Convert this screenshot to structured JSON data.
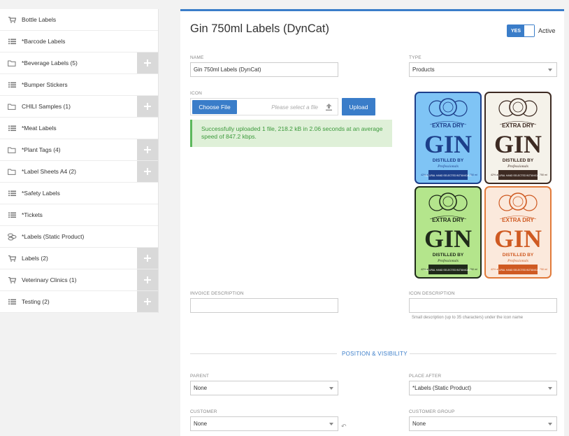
{
  "sidebar": {
    "items": [
      {
        "label": "Bottle Labels",
        "icon": "cart-icon",
        "plus": false
      },
      {
        "label": "*Barcode Labels",
        "icon": "list-icon",
        "plus": false
      },
      {
        "label": "*Beverage Labels (5)",
        "icon": "folder-icon",
        "plus": true
      },
      {
        "label": "*Bumper Stickers",
        "icon": "list-icon",
        "plus": false
      },
      {
        "label": "CHILI Samples (1)",
        "icon": "folder-icon",
        "plus": true
      },
      {
        "label": "*Meat Labels",
        "icon": "list-icon",
        "plus": false
      },
      {
        "label": "*Plant Tags (4)",
        "icon": "folder-icon",
        "plus": true
      },
      {
        "label": "*Label Sheets A4 (2)",
        "icon": "folder-icon",
        "plus": true
      },
      {
        "label": "*Safety Labels",
        "icon": "list-icon",
        "plus": false
      },
      {
        "label": "*Tickets",
        "icon": "list-icon",
        "plus": false
      },
      {
        "label": "*Labels (Static Product)",
        "icon": "coins-icon",
        "plus": false
      },
      {
        "label": "Labels (2)",
        "icon": "cart-icon",
        "plus": true
      },
      {
        "label": "Veterinary Clinics (1)",
        "icon": "cart-icon",
        "plus": true
      },
      {
        "label": "Testing (2)",
        "icon": "list-icon",
        "plus": true
      }
    ]
  },
  "header": {
    "title": "Gin 750ml Labels (DynCat)",
    "toggle_text": "YES",
    "toggle_label": "Active"
  },
  "form": {
    "name_label": "NAME",
    "name_value": "Gin 750ml Labels (DynCat)",
    "type_label": "TYPE",
    "type_value": "Products",
    "icon_label": "ICON",
    "choose_file": "Choose File",
    "file_placeholder": "Please select a file",
    "upload": "Upload",
    "success_message": "Successfully uploaded 1 file, 218.2 kB in 2.06 seconds at an average speed of 847.2 kbps.",
    "invoice_desc_label": "INVOICE DESCRIPTION",
    "icon_desc_label": "ICON DESCRIPTION",
    "icon_desc_hint": "Small description (up to 35 characters) under the icon name",
    "section_title": "POSITION & VISIBILITY",
    "parent_label": "PARENT",
    "parent_value": "None",
    "place_after_label": "PLACE AFTER",
    "place_after_value": "*Labels (Static Product)",
    "customer_label": "CUSTOMER",
    "customer_value": "None",
    "customer_group_label": "CUSTOMER GROUP",
    "customer_group_value": "None"
  },
  "gin_labels": [
    {
      "name": "blue-gin-label",
      "bg": "#7fc4f5",
      "border": "#1d3f8a",
      "word_color": "#1d3f8a",
      "band": "#1d3f8a"
    },
    {
      "name": "white-gin-label",
      "bg": "#f5f2ea",
      "border": "#3d2a22",
      "word_color": "#3d2a22",
      "band": "#3d2a22"
    },
    {
      "name": "green-gin-label",
      "bg": "#b4e58c",
      "border": "#1f2a1a",
      "word_color": "#1f2a1a",
      "band": "#1f2a1a"
    },
    {
      "name": "orange-gin-label",
      "bg": "#fbe9dc",
      "border": "#e17a3a",
      "word_color": "#cf5a22",
      "band": "#cf5a22"
    }
  ],
  "gin_text": {
    "top": "EXTRA DRY",
    "word": "GIN",
    "distilled": "DISTILLED BY",
    "by": "Professionals",
    "bottom": "NATURAL HAND SELECTED BOTANICALS",
    "abv": "42% alc",
    "vol": "750 ml"
  },
  "colors": {
    "accent": "#3a7dc9",
    "success_bg": "#dff0d8",
    "success_text": "#3c9a3c"
  }
}
